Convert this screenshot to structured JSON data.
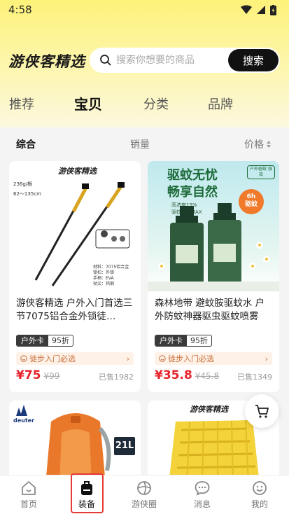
{
  "status": {
    "time": "4:58"
  },
  "header": {
    "logo": "游侠客精选",
    "search_placeholder": "搜索你想要的商品",
    "search_button": "搜索"
  },
  "tabs": [
    {
      "label": "推荐"
    },
    {
      "label": "宝贝"
    },
    {
      "label": "分类"
    },
    {
      "label": "品牌"
    }
  ],
  "filters": {
    "comprehensive": "综合",
    "sales": "销量",
    "price": "价格"
  },
  "products": [
    {
      "title": "游侠客精选 户外入门首选三节7075铝合金外锁徒…",
      "tag_a": "户外卡",
      "tag_b": "95折",
      "promo": "徒步入门必选",
      "price": "¥75",
      "old_price": "¥99",
      "sold": "已售1982",
      "img": {
        "brand": "游侠客精选",
        "weight": "236g/根",
        "length": "62～135cm",
        "spec1": "材料：7075铝合金",
        "spec2": "锁扣：外锁",
        "spec3": "手柄：EVA",
        "spec4": "杖尖：钨钢"
      }
    },
    {
      "title": "森林地带 避蚊胺驱蚊水 户外防蚊神器驱虫驱蚊喷雾",
      "tag_a": "户外卡",
      "tag_b": "95折",
      "promo": "徒步入门必选",
      "price": "¥35.8",
      "old_price": "¥45.8",
      "sold": "已售1349",
      "img": {
        "line1": "驱蚊无忧",
        "line2": "畅享自然",
        "sub1": "高浓度15%",
        "sub2": "驱蚊能力MAX",
        "badge_top": "6h",
        "badge_bot": "驱蚊",
        "corner": "户外驱蚊 强效"
      }
    },
    {
      "img": {
        "brand": "deuter",
        "size": "21L"
      }
    },
    {
      "img": {
        "brand": "游侠客精选"
      }
    }
  ],
  "nav": [
    {
      "label": "首页"
    },
    {
      "label": "装备"
    },
    {
      "label": "游侠圈"
    },
    {
      "label": "消息"
    },
    {
      "label": "我的"
    }
  ],
  "colors": {
    "accent_yellow": "#fdf27a",
    "price_red": "#e8232b",
    "highlight": "#e53935"
  }
}
